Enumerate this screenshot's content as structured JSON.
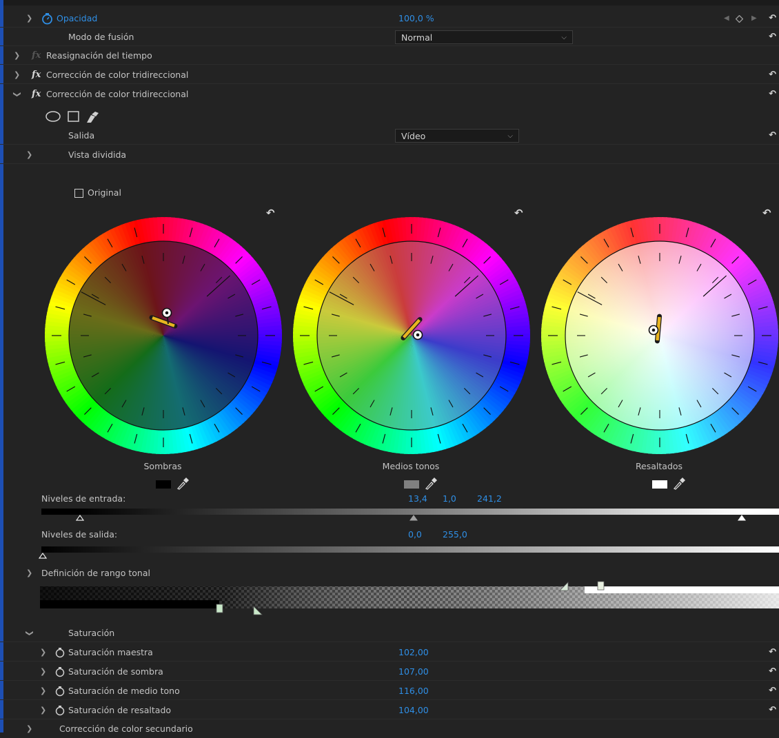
{
  "rows": {
    "opacity": {
      "label": "Opacidad",
      "value": "100,0 %"
    },
    "blend": {
      "label": "Modo de fusión",
      "value": "Normal"
    },
    "time_remap": {
      "label": "Reasignación del tiempo"
    },
    "effect1": {
      "label": "Corrección de color tridireccional"
    },
    "effect2": {
      "label": "Corrección de color tridireccional"
    },
    "output": {
      "label": "Salida",
      "value": "Vídeo"
    },
    "split_view": {
      "label": "Vista dividida"
    }
  },
  "fx_glyph": "fx",
  "original_label": "Original",
  "wheels": [
    {
      "name": "Sombras",
      "swatch": "#000000"
    },
    {
      "name": "Medios tonos",
      "swatch": "#808080"
    },
    {
      "name": "Resaltados",
      "swatch": "#ffffff"
    }
  ],
  "input_levels": {
    "label": "Niveles de entrada:",
    "black": "13,4",
    "gamma": "1,0",
    "white": "241,2"
  },
  "output_levels": {
    "label": "Niveles de salida:",
    "black": "0,0",
    "white": "255,0"
  },
  "tonal_range": {
    "label": "Definición de rango tonal"
  },
  "saturation": {
    "label": "Saturación",
    "items": [
      {
        "label": "Saturación maestra",
        "value": "102,00"
      },
      {
        "label": "Saturación de sombra",
        "value": "107,00"
      },
      {
        "label": "Saturación de medio tono",
        "value": "116,00"
      },
      {
        "label": "Saturación de resaltado",
        "value": "104,00"
      }
    ]
  },
  "secondary": {
    "label": "Corrección de color secundario"
  },
  "icons": [
    "stopwatch-icon",
    "chevron-right-icon",
    "chevron-down-icon",
    "reset-icon",
    "ellipse-mask-icon",
    "rectangle-mask-icon",
    "pen-mask-icon",
    "eyedropper-icon",
    "keyframe-nav-icon"
  ],
  "colors": {
    "accent": "#2f8fe6",
    "panel": "#232323",
    "handle": "#e8b420"
  }
}
